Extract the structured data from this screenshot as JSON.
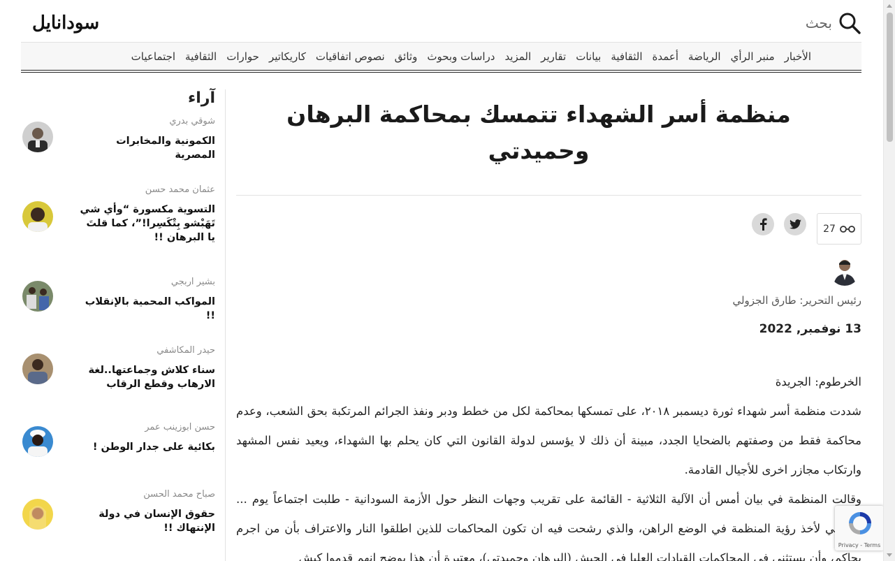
{
  "header": {
    "logo": "سودانايل",
    "search_label": "بحث"
  },
  "nav": {
    "items": [
      "الأخبار",
      "منبر الرأي",
      "الرياضة",
      "أعمدة",
      "الثقافية",
      "بيانات",
      "تقارير",
      "المزيد",
      "دراسات وبحوث",
      "وثائق",
      "نصوص اتفاقيات",
      "كاريكاتير",
      "حوارات",
      "الثقافية",
      "اجتماعيات"
    ]
  },
  "sidebar": {
    "title": "آراء",
    "items": [
      {
        "author": "شوقي بدري",
        "title": "الكمونية والمخابرات المصرية"
      },
      {
        "author": "عثمان محمد حسن",
        "title": "التسوية مكسورة “وأي شي تَهَبْشو بِتْكَسِرا!”، كما قلتَ يا البرهان !!"
      },
      {
        "author": "بشير اربجي",
        "title": "المواكب المحمية بالإنقلاب !!"
      },
      {
        "author": "حيدر المكاشفي",
        "title": "سناء كلاش وجماعتها..لغة الارهاب وقطع الرقاب"
      },
      {
        "author": "حسن ابوزينب عمر",
        "title": "بكائية على جدار الوطن !"
      },
      {
        "author": "صباح محمد الحسن",
        "title": "حقوق الإنسان في دولة الإنتهاك !!"
      }
    ]
  },
  "article": {
    "title": "منظمة أسر الشهداء تتمسك بمحاكمة البرهان وحميدتي",
    "views": "27",
    "editor": "رئيس التحرير: طارق الجزولي",
    "date": "13 نوفمبر, 2022",
    "paragraphs": [
      "الخرطوم: الجريدة",
      "شددت منظمة أسر شهداء ثورة ديسمبر ٢٠١٨، على تمسكها بمحاكمة لكل من خطط ودبر ونفذ الجرائم المرتكبة بحق الشعب، وعدم محاكمة فقط من وصفتهم بالضحايا الجدد، مبينة أن ذلك لا يؤسس لدولة القانون التي كان يحلم بها الشهداء، ويعيد نفس المشهد وارتكاب مجازر اخرى للأجيال القادمة.",
      "وقالت المنظمة في بيان أمس أن الآلية الثلاثية - القائمة على تقريب وجهات النظر حول الأزمة السودانية - طلبت اجتماعاً يوم ... الماضي لأخذ رؤية المنظمة في الوضع الراهن، والذي رشحت فيه ان تكون المحاكمات للذين اطلقوا النار والاعتراف بأن من اجرم يحاكم، وأن يستثنى في المحاكمات القيادات العليا في الجيش (البرهان وحميدتي)، معتبرة أن هذا يوضح انهم قدموا كبش"
    ]
  },
  "recaptcha": {
    "text": "Privacy - Terms"
  }
}
